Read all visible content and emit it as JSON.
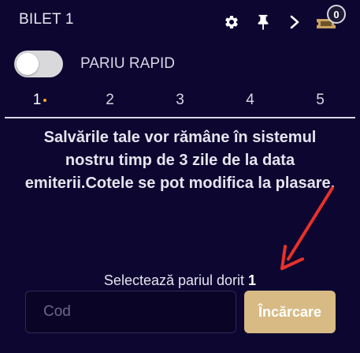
{
  "header": {
    "title": "BILET 1",
    "icons": [
      "gear-icon",
      "pin-icon",
      "chevron-right-icon",
      "ticket-icon"
    ],
    "ticket_count": "0"
  },
  "quick_bet": {
    "label": "PARIU RAPID",
    "enabled": false
  },
  "tabs": [
    {
      "label": "1",
      "active": true
    },
    {
      "label": "2",
      "active": false
    },
    {
      "label": "3",
      "active": false
    },
    {
      "label": "4",
      "active": false
    },
    {
      "label": "5",
      "active": false
    }
  ],
  "info_text": "Salvările tale vor rămâne în sistemul nostru timp de 3 zile de la data emiterii.Cotele se pot modifica la plasare.",
  "select_bet": {
    "label": "Selectează pariul dorit",
    "number": "1"
  },
  "code_input": {
    "placeholder": "Cod",
    "value": ""
  },
  "load_button": {
    "label": "Încărcare"
  },
  "colors": {
    "background": "#0c0630",
    "accent_button": "#d7ba84",
    "annotation_arrow": "#e8312a",
    "tab_dot": "#f2a72c"
  }
}
